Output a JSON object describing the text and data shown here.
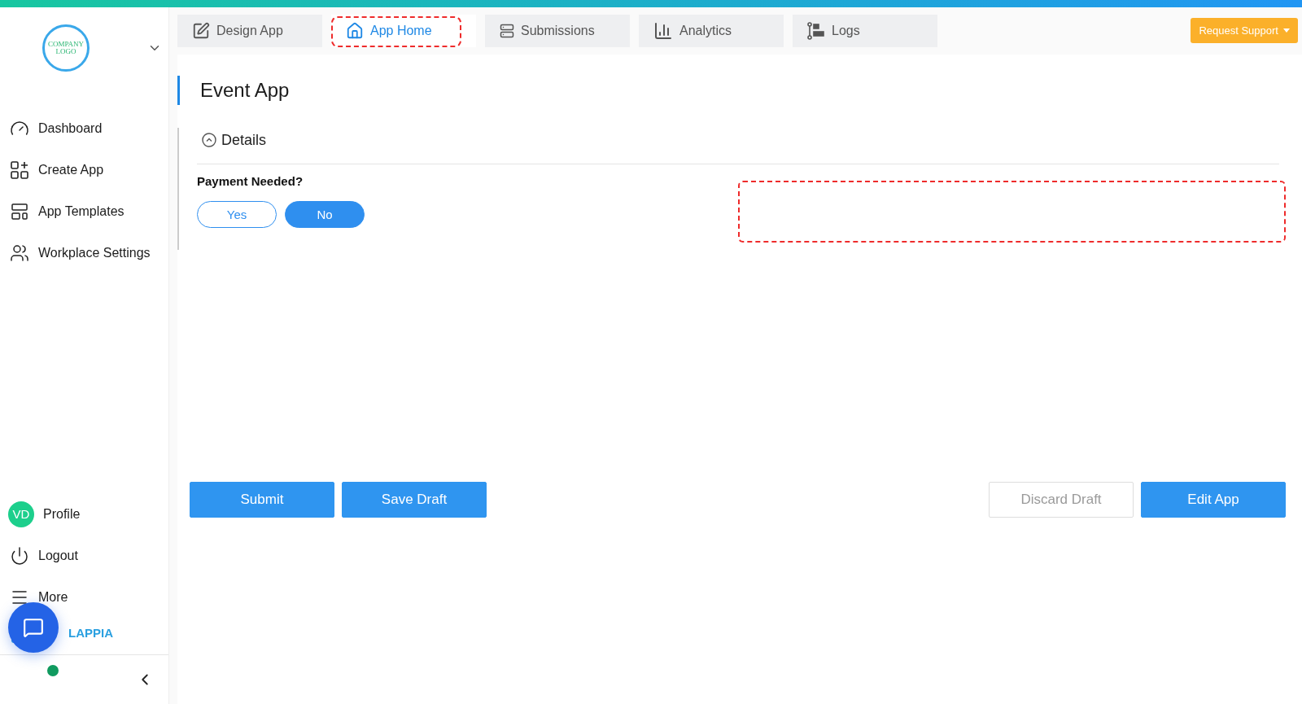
{
  "sidebar": {
    "logo_text": "COMPANY LOGO",
    "items": [
      {
        "label": "Dashboard"
      },
      {
        "label": "Create App"
      },
      {
        "label": "App Templates"
      },
      {
        "label": "Workplace Settings"
      }
    ],
    "profile": {
      "initials": "VD",
      "label": "Profile"
    },
    "bottom_items": [
      {
        "label": "Logout"
      },
      {
        "label": "More"
      }
    ],
    "brand": "LAPPIA"
  },
  "tabs": [
    {
      "label": "Design App",
      "selected": false,
      "highlighted": false
    },
    {
      "label": "App Home",
      "selected": true,
      "highlighted": true
    },
    {
      "label": "Submissions",
      "selected": false,
      "highlighted": false
    },
    {
      "label": "Analytics",
      "selected": false,
      "highlighted": false
    },
    {
      "label": "Logs",
      "selected": false,
      "highlighted": false
    }
  ],
  "request_support": "Request Support",
  "title": "Event App",
  "section": {
    "label": "Details",
    "expanded": true
  },
  "question": {
    "label": "Payment Needed?",
    "options": [
      {
        "label": "Yes",
        "selected": false
      },
      {
        "label": "No",
        "selected": true
      }
    ]
  },
  "highlight_area": {
    "kind": "annotation"
  },
  "actions_left": [
    {
      "label": "Submit",
      "disabled": false
    },
    {
      "label": "Save Draft",
      "disabled": false
    }
  ],
  "actions_right": [
    {
      "label": "Discard Draft",
      "disabled": true
    },
    {
      "label": "Edit App",
      "disabled": false
    }
  ]
}
